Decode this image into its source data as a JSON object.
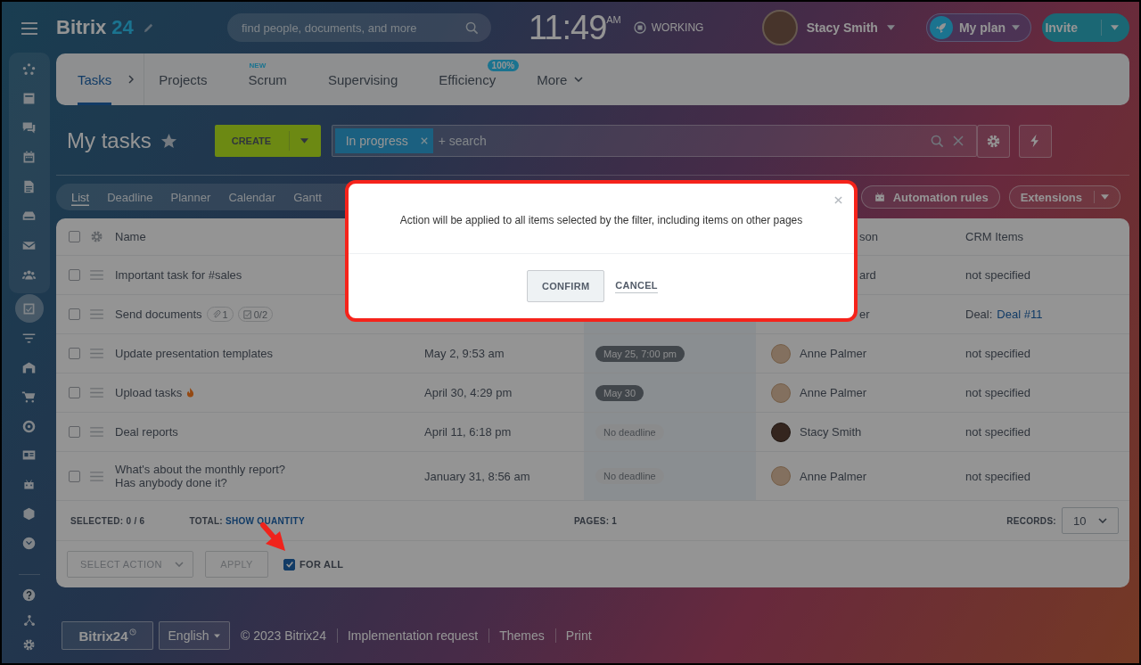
{
  "header": {
    "logo_word": "Bitrix",
    "logo_number": "24",
    "search": {
      "placeholder": "find people, documents, and more"
    },
    "clock": "11:49",
    "clock_suffix": "AM",
    "work_status": "WORKING",
    "user": "Stacy Smith",
    "plan_button": "My plan",
    "invite_button": "Invite"
  },
  "sidebar": {
    "items": [
      {
        "selected": false
      },
      {
        "selected": false
      },
      {
        "selected": false
      },
      {
        "selected": false
      },
      {
        "selected": false
      },
      {
        "selected": false
      },
      {
        "selected": false
      },
      {
        "selected": false
      },
      {
        "selected": true
      },
      {
        "selected": false
      },
      {
        "selected": false
      },
      {
        "selected": false
      },
      {
        "selected": false
      },
      {
        "selected": false
      },
      {
        "selected": false
      },
      {
        "selected": false
      },
      {
        "selected": false
      }
    ]
  },
  "nav_tabs": [
    {
      "label": "Tasks",
      "selected": true
    },
    {
      "label": "Projects",
      "selected": false
    },
    {
      "label": "Scrum",
      "selected": false,
      "badge": "NEW"
    },
    {
      "label": "Supervising",
      "selected": false
    },
    {
      "label": "Efficiency",
      "selected": false,
      "counter": "100%"
    },
    {
      "label": "More",
      "selected": false
    }
  ],
  "page": {
    "title": "My tasks",
    "create_button": "CREATE",
    "filter": {
      "tag": "In progress",
      "placeholder": "+ search"
    }
  },
  "view_tabs": [
    {
      "label": "List",
      "selected": true
    },
    {
      "label": "Deadline",
      "selected": false
    },
    {
      "label": "Planner",
      "selected": false
    },
    {
      "label": "Calendar",
      "selected": false
    },
    {
      "label": "Gantt",
      "selected": false
    }
  ],
  "toolbar_buttons": {
    "automation": "Automation rules",
    "extensions": "Extensions"
  },
  "table": {
    "select_all_checked": false,
    "columns": {
      "name": "Name",
      "column_5": "son",
      "crm_items": "CRM Items"
    },
    "rows": [
      {
        "checked": false,
        "name": "Important task for #sales",
        "hot": false,
        "responsible_fragment": "ard",
        "crm": "not specified"
      },
      {
        "checked": false,
        "name": "Send documents",
        "attachments": "1",
        "checklist": "0/2",
        "hot": false,
        "responsible_fragment": "er",
        "crm_label": "Deal:",
        "crm_link": "Deal #11"
      },
      {
        "checked": false,
        "name": "Update presentation templates",
        "hot": false,
        "activity": "May 2, 9:53 am",
        "deadline": {
          "text": "May 25, 7:00 pm",
          "kind": "date"
        },
        "responsible": "Anne Palmer",
        "crm": "not specified"
      },
      {
        "checked": false,
        "name": "Upload tasks",
        "hot": true,
        "activity": "April 30, 4:29 pm",
        "deadline": {
          "text": "May 30",
          "kind": "date"
        },
        "responsible": "Anne Palmer",
        "crm": "not specified"
      },
      {
        "checked": false,
        "name": "Deal reports",
        "hot": false,
        "activity": "April 11, 6:18 pm",
        "deadline": {
          "text": "No deadline",
          "kind": "none"
        },
        "responsible": "Stacy Smith",
        "crm": "not specified"
      },
      {
        "checked": false,
        "name": "What's about the monthly report?\nHas anybody done it?",
        "hot": false,
        "activity": "January 31, 8:56 am",
        "deadline": {
          "text": "No deadline",
          "kind": "none"
        },
        "responsible": "Anne Palmer",
        "crm": "not specified"
      }
    ],
    "summary": {
      "selected_label": "SELECTED:",
      "selected_value": "0 / 6",
      "total_label": "TOTAL:",
      "total_link": "SHOW QUANTITY",
      "pages_label": "PAGES:",
      "pages_value": "1",
      "records_label": "RECORDS:",
      "records_value": "10"
    }
  },
  "actions": {
    "select_action": "SELECT ACTION",
    "apply": {
      "label": "APPLY",
      "disabled": true
    },
    "for_all": {
      "label": "FOR ALL",
      "checked": true
    }
  },
  "dialog": {
    "message": "Action will be applied to all items selected by the filter, including items on other pages",
    "confirm": "CONFIRM",
    "cancel": "CANCEL"
  },
  "footer": {
    "brand": "Bitrix24",
    "language": "English",
    "copyright": "© 2023 Bitrix24",
    "links": [
      "Implementation request",
      "Themes",
      "Print"
    ]
  }
}
